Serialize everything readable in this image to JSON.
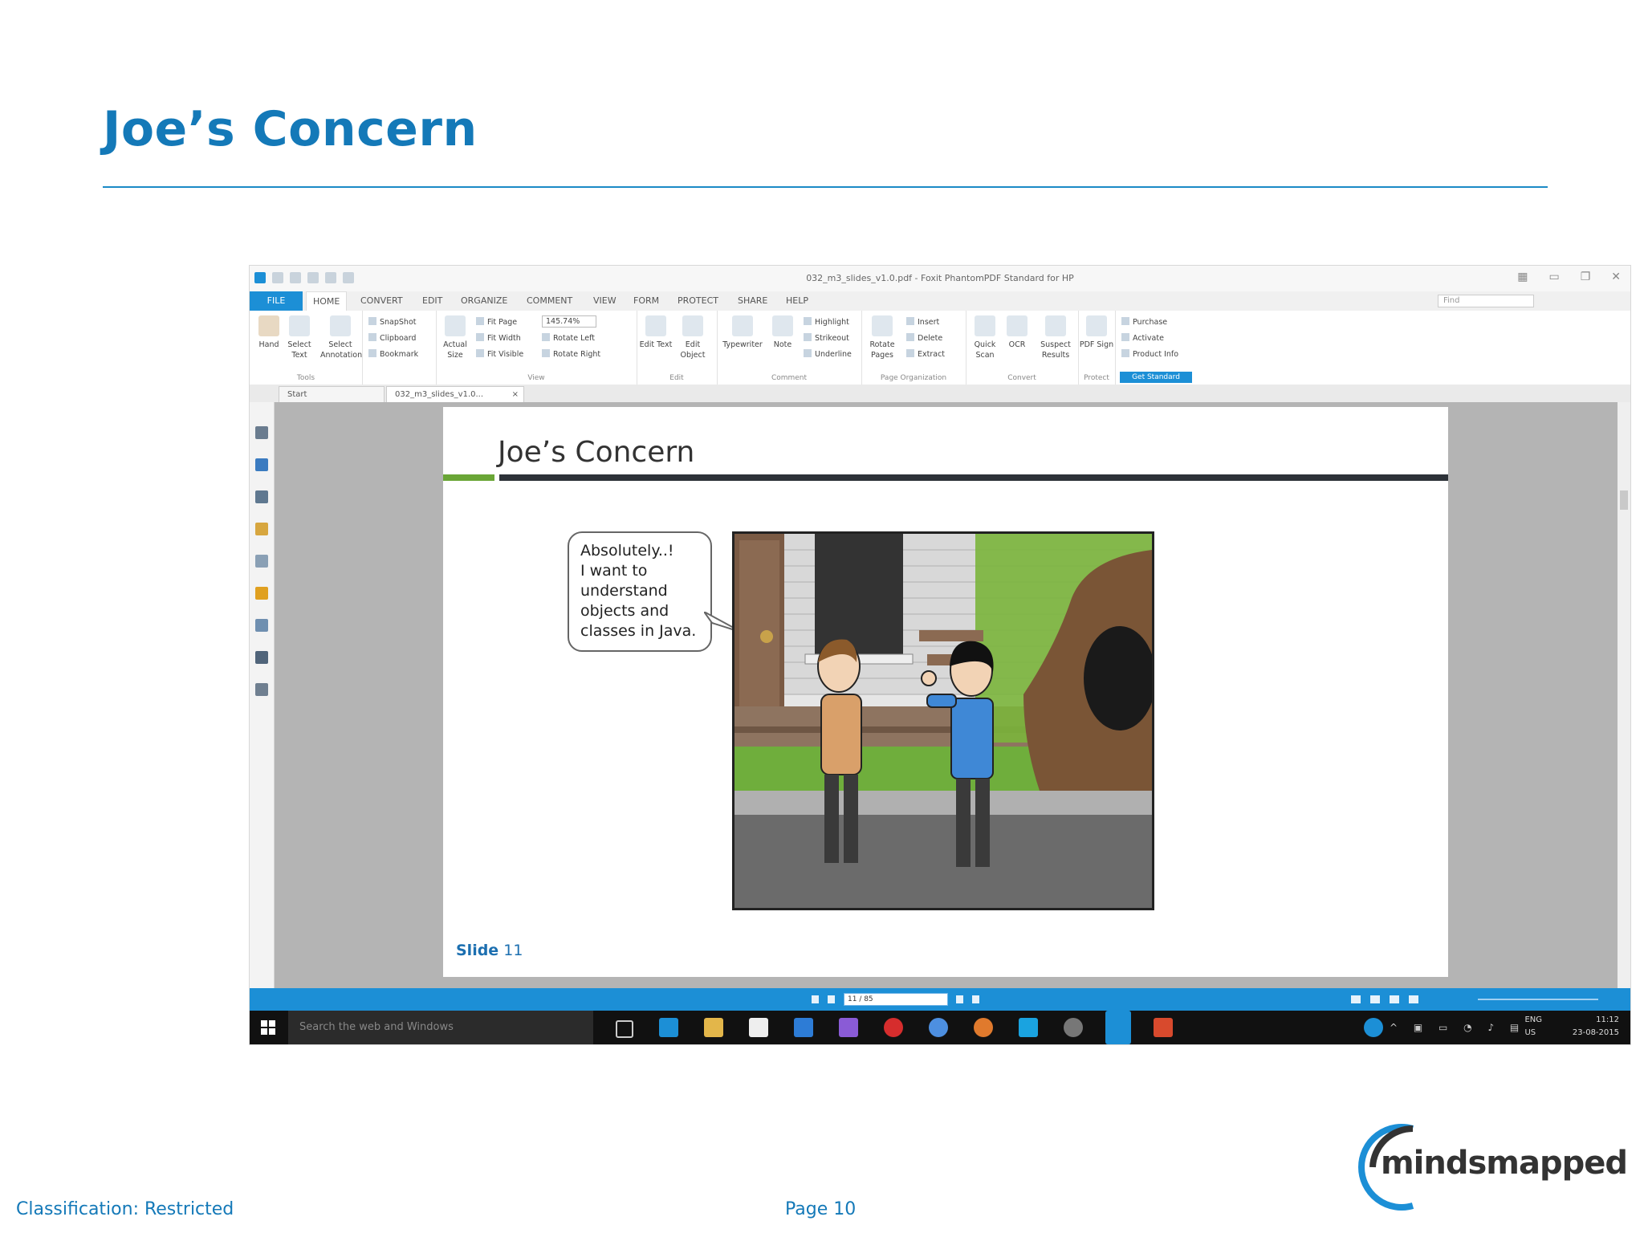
{
  "slide": {
    "title": "Joe’s Concern",
    "classification": "Classification: Restricted",
    "page": "Page 10",
    "logo": "mindsmapped"
  },
  "app": {
    "window_title": "032_m3_slides_v1.0.pdf - Foxit PhantomPDF Standard for HP",
    "tabs": [
      "FILE",
      "HOME",
      "CONVERT",
      "EDIT",
      "ORGANIZE",
      "COMMENT",
      "VIEW",
      "FORM",
      "PROTECT",
      "SHARE",
      "HELP"
    ],
    "find_placeholder": "Find",
    "ribbon": {
      "tools": {
        "label": "Tools",
        "hand": "Hand",
        "select_text": "Select Text",
        "select_annotation": "Select Annotation",
        "snapshot": "SnapShot",
        "clipboard": "Clipboard",
        "bookmark": "Bookmark"
      },
      "view": {
        "label": "View",
        "actual_size": "Actual Size",
        "fit_page": "Fit Page",
        "fit_width": "Fit Width",
        "fit_visible": "Fit Visible",
        "zoom": "145.74%",
        "rotate_left": "Rotate Left",
        "rotate_right": "Rotate Right"
      },
      "edit": {
        "label": "Edit",
        "edit_text": "Edit Text",
        "edit_object": "Edit Object"
      },
      "comment": {
        "label": "Comment",
        "typewriter": "Typewriter",
        "note": "Note",
        "highlight": "Highlight",
        "strikeout": "Strikeout",
        "underline": "Underline"
      },
      "page_org": {
        "label": "Page Organization",
        "rotate_pages": "Rotate Pages",
        "insert": "Insert",
        "delete": "Delete",
        "extract": "Extract"
      },
      "convert": {
        "label": "Convert",
        "quick_scan": "Quick Scan",
        "ocr": "OCR",
        "suspect_results": "Suspect Results"
      },
      "protect": {
        "label": "Protect",
        "pdf_sign": "PDF Sign"
      },
      "purchase": "Purchase",
      "activate": "Activate",
      "product_info": "Product Info",
      "get_standard": "Get Standard"
    },
    "doc_tabs": [
      "Start",
      "032_m3_slides_v1.0..."
    ],
    "document": {
      "title": "Joe’s Concern",
      "speech": [
        "Absolutely..!",
        "I want to",
        "understand",
        "objects and",
        "classes in Java."
      ],
      "slide_word": "Slide",
      "slide_number": "11"
    },
    "status": {
      "page_field": "11 / 85"
    },
    "taskbar": {
      "search_placeholder": "Search the web and Windows",
      "lang": "ENG",
      "region": "US",
      "time": "11:12",
      "date": "23-08-2015"
    }
  },
  "colors": {
    "accent": "#1479b8",
    "app_blue": "#1c8fd6",
    "green_bar": "#6aa636",
    "dark_bar": "#2d3238"
  }
}
